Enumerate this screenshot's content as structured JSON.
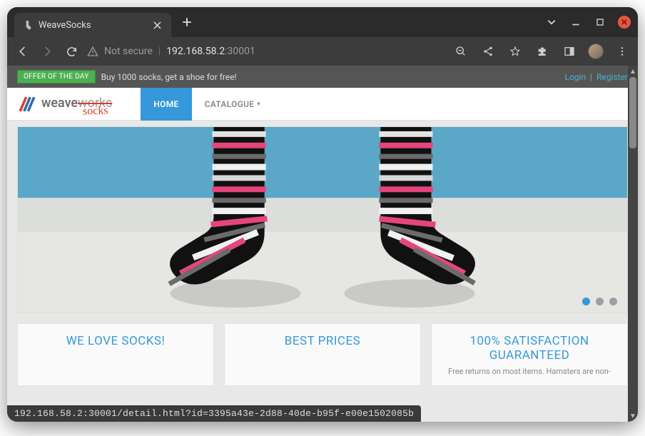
{
  "browser": {
    "tab_title": "WeaveSocks",
    "address": {
      "insecure_label": "Not secure",
      "host": "192.168.58.2",
      "port": ":30001"
    },
    "status_url": "192.168.58.2:30001/detail.html?id=3395a43e-2d88-40de-b95f-e00e1502085b"
  },
  "offer": {
    "badge": "OFFER OF THE DAY",
    "text": "Buy 1000 socks, get a shoe for free!"
  },
  "auth": {
    "login": "Login",
    "register": "Register"
  },
  "logo": {
    "weave": "weave",
    "works": "works",
    "socks": "socks"
  },
  "nav": {
    "home": "HOME",
    "catalogue": "CATALOGUE"
  },
  "carousel": {
    "active_index": 0,
    "count": 3
  },
  "cards": [
    {
      "title": "WE LOVE SOCKS!",
      "body": ""
    },
    {
      "title": "BEST PRICES",
      "body": ""
    },
    {
      "title": "100% SATISFACTION GUARANTEED",
      "body": "Free returns on most items. Hamsters are non-"
    }
  ]
}
